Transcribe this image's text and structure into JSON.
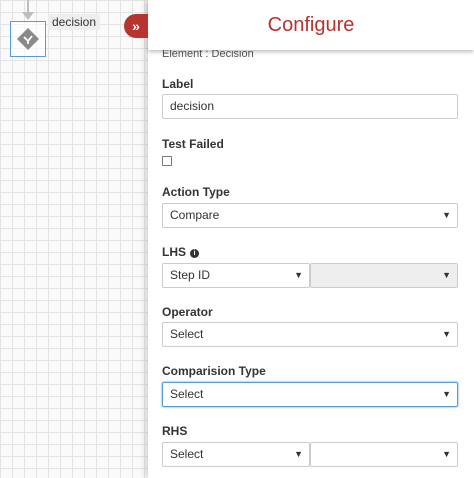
{
  "canvas": {
    "node_label": "decision"
  },
  "panel": {
    "title": "Configure",
    "element_line": "Element : Decision",
    "label": {
      "title": "Label",
      "value": "decision"
    },
    "test_failed": {
      "title": "Test Failed",
      "checked": false
    },
    "action_type": {
      "title": "Action Type",
      "value": "Compare"
    },
    "lhs": {
      "title": "LHS",
      "left_value": "Step ID",
      "right_value": ""
    },
    "operator": {
      "title": "Operator",
      "value": "Select"
    },
    "comparision_type": {
      "title": "Comparision Type",
      "value": "Select"
    },
    "rhs": {
      "title": "RHS",
      "left_value": "Select",
      "right_value": ""
    }
  },
  "colors": {
    "accent": "#b8322f",
    "focus": "#5b9bd5"
  },
  "icons": {
    "collapse": "double-chevron-right-icon",
    "node": "decision-diamond-icon",
    "info": "info-icon",
    "caret": "caret-down-icon"
  }
}
